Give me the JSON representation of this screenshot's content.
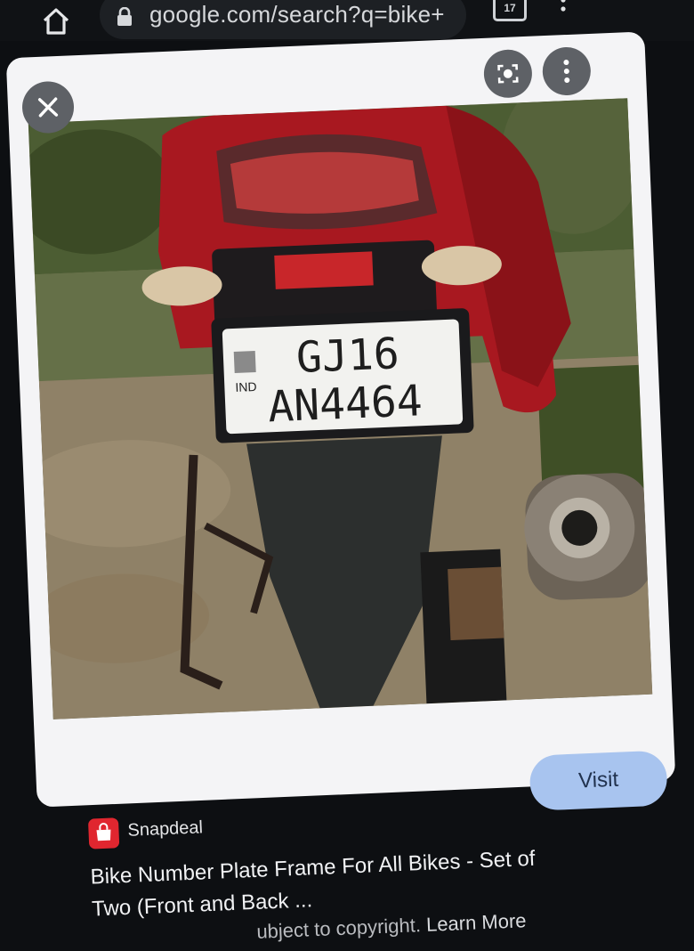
{
  "browser": {
    "url": "google.com/search?q=bike+",
    "tab_count": "17"
  },
  "viewer": {
    "plate_line1": "GJ16",
    "plate_line2": "AN4464",
    "plate_country": "IND"
  },
  "result": {
    "source": "Snapdeal",
    "title": "Bike Number Plate Frame For All Bikes - Set of Two (Front and Back ...",
    "visit_label": "Visit",
    "copyright": "ubject to copyright.",
    "learn_more": "Learn More"
  }
}
